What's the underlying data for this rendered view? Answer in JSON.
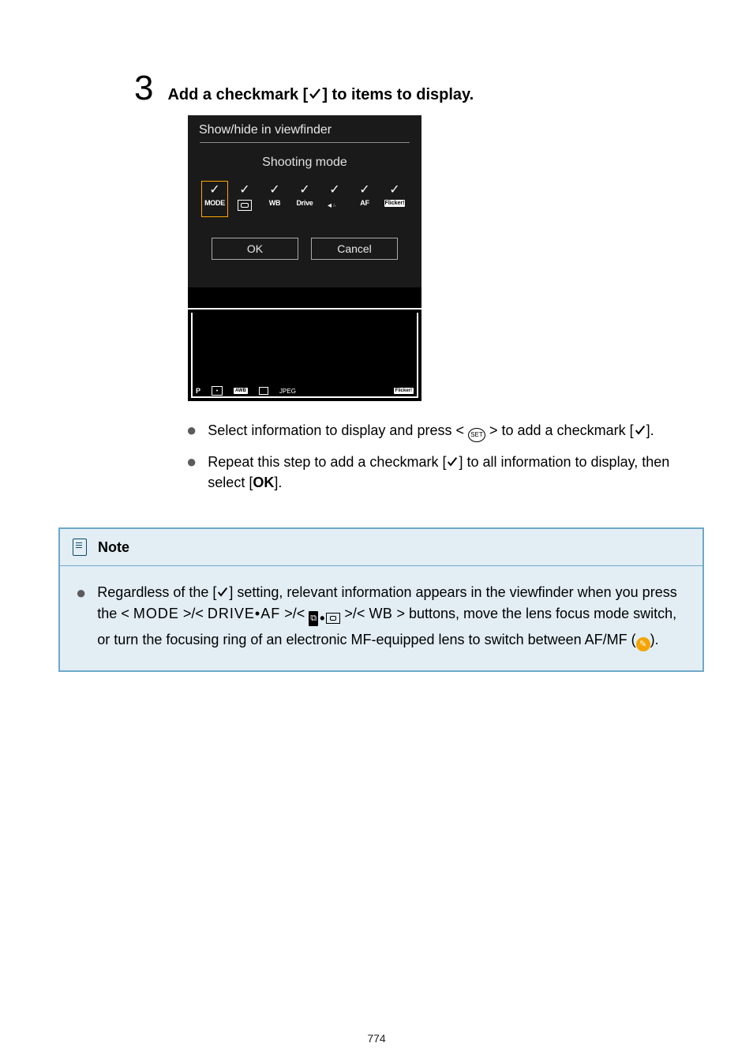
{
  "step": {
    "number": "3",
    "dot": ".",
    "title_before": "Add a checkmark [",
    "title_after": "] to items to display."
  },
  "cam": {
    "title": "Show/hide in viewfinder",
    "subtitle": "Shooting mode",
    "icons": {
      "mode": "MODE",
      "wb": "WB",
      "drive": "Drive",
      "af": "AF",
      "flicker": "Flicker!"
    },
    "ok": "OK",
    "cancel": "Cancel",
    "status": {
      "p": "P",
      "awb": "AWB",
      "jpeg": "JPEG",
      "flicker": "Flicker!"
    }
  },
  "bullets": {
    "b1_a": "Select information to display and press < ",
    "b1_set": "SET",
    "b1_b": " > to add a checkmark [",
    "b1_c": "].",
    "b2_a": "Repeat this step to add a checkmark [",
    "b2_b": "] to all information to display, then select [",
    "b2_ok": "OK",
    "b2_c": "]."
  },
  "note": {
    "title": "Note",
    "body_a": "Regardless of the [",
    "body_b": "] setting, relevant information appears in the viewfinder when you press the < ",
    "mode": "MODE",
    "sep": " >/< ",
    "driveaf": "DRIVE•AF",
    "comp": "±",
    "wb": "WB",
    "body_c": " > buttons, move the lens focus mode switch, or turn the focusing ring of an electronic MF-equipped lens to switch between AF/MF (",
    "body_d": ")."
  },
  "pagenum": "774"
}
